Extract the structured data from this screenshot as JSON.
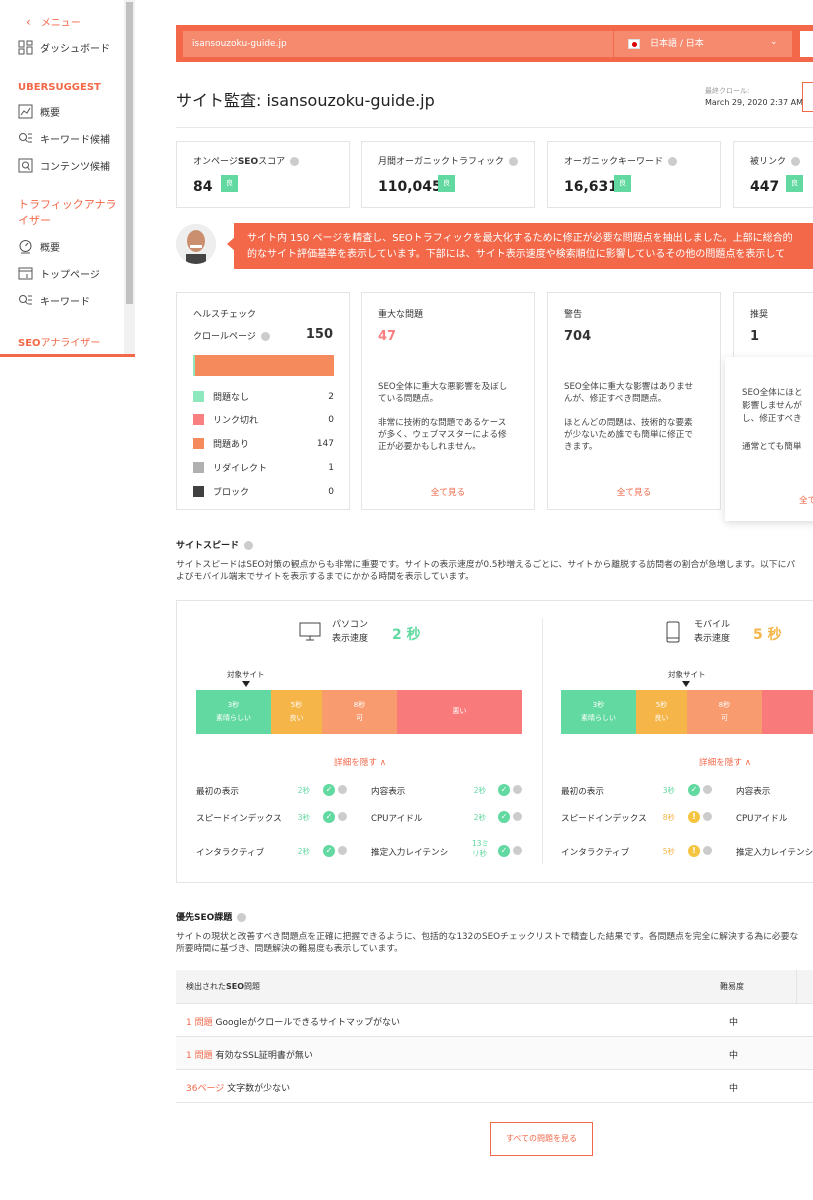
{
  "sidebar": {
    "menu_label": "メニュー",
    "dashboard": "ダッシュボード",
    "ubersuggest_heading": "UBERSUGGEST",
    "ub_items": [
      "概要",
      "キーワード候補",
      "コンテンツ候補"
    ],
    "traffic_heading": "トラフィックアナライザー",
    "traffic_items": [
      "概要",
      "トップページ",
      "キーワード"
    ],
    "seo_heading_prefix": "SEO",
    "seo_heading_suffix": "アナライザー"
  },
  "topbar": {
    "url_value": "isansouzoku-guide.jp",
    "language": "日本語 / 日本"
  },
  "header": {
    "title": "サイト監査: isansouzoku-guide.jp",
    "last_crawl_label": "最終クロール:",
    "last_crawl_value": "March 29, 2020 2:37 AM"
  },
  "metrics": [
    {
      "label_pre": "オンページ",
      "label_bold": "SEO",
      "label_post": "スコア",
      "value": "84",
      "badge": "良"
    },
    {
      "label_pre": "月間オーガニックトラフィック",
      "label_bold": "",
      "label_post": "",
      "value": "110,045",
      "badge": "良"
    },
    {
      "label_pre": "オーガニックキーワード",
      "label_bold": "",
      "label_post": "",
      "value": "16,631",
      "badge": "良"
    },
    {
      "label_pre": "被リンク",
      "label_bold": "",
      "label_post": "",
      "value": "447",
      "badge": "良"
    }
  ],
  "banner": {
    "line1": "サイト内 150 ページを精査し、SEOトラフィックを最大化するために修正が必要な問題点を抽出しました。上部に総合的",
    "line2": "的なサイト評価基準を表示しています。下部には、サイト表示速度や検索順位に影響しているその他の問題点を表示して"
  },
  "health": {
    "title": "ヘルスチェック",
    "crawl_label": "クロールページ",
    "crawl_value": "150",
    "legend": [
      {
        "label": "問題なし",
        "value": "2",
        "color": "#8de8bd"
      },
      {
        "label": "リンク切れ",
        "value": "0",
        "color": "#f98080"
      },
      {
        "label": "問題あり",
        "value": "147",
        "color": "#f58a5d"
      },
      {
        "label": "リダイレクト",
        "value": "1",
        "color": "#b0b0b0"
      },
      {
        "label": "ブロック",
        "value": "0",
        "color": "#404040"
      }
    ]
  },
  "issues": {
    "critical": {
      "title": "重大な問題",
      "value": "47",
      "desc1": "SEO全体に重大な悪影響を及ぼしている問題点。",
      "desc2": "非常に技術的な問題であるケースが多く、ウェブマスターによる修正が必要かもしれません。",
      "link": "全て見る"
    },
    "warning": {
      "title": "警告",
      "value": "704",
      "desc1": "SEO全体に重大な影響はありませんが、修正すべき問題点。",
      "desc2": "ほとんどの問題は、技術的な要素が少ないため誰でも簡単に修正できます。",
      "link": "全て見る"
    },
    "recommend": {
      "title": "推奨",
      "value": "1",
      "desc1": "SEO全体にほと",
      "desc1b": "影響しませんが",
      "desc1c": "し、修正すべき",
      "desc2": "通常とても簡単",
      "link": "全て"
    }
  },
  "speed": {
    "title": "サイトスピード",
    "desc1": "サイトスピードはSEO対策の観点からも非常に重要です。サイトの表示速度が0.5秒増えるごとに、サイトから離脱する訪問者の割合が急増します。以下にパ",
    "desc2": "よびモバイル端末でサイトを表示するまでにかかる時間を表示しています。",
    "desktop": {
      "name": "パソコン",
      "sub": "表示速度",
      "value": "2 秒"
    },
    "mobile": {
      "name": "モバイル",
      "sub": "表示速度",
      "value": "5 秒"
    },
    "target_label": "対象サイト",
    "segments": [
      {
        "t": "3秒",
        "l": "素晴らしい"
      },
      {
        "t": "5秒",
        "l": "良い"
      },
      {
        "t": "8秒",
        "l": "可"
      },
      {
        "t": "",
        "l": "悪い"
      }
    ],
    "toggle": "詳細を隠す ∧",
    "metrics_labels": [
      "最初の表示",
      "スピードインデックス",
      "インタラクティブ",
      "内容表示",
      "CPUアイドル",
      "推定入力レイテンシ"
    ],
    "desktop_values": [
      "2秒",
      "3秒",
      "2秒",
      "2秒",
      "2秒",
      "13ミリ秒"
    ],
    "mobile_values": [
      "3秒",
      "8秒",
      "5秒"
    ]
  },
  "priority": {
    "title": "優先SEO課題",
    "desc1": "サイトの現状と改善すべき問題点を正確に把握できるように、包括的な132のSEOチェックリストで精査した結果です。各問題点を完全に解決する為に必要な",
    "desc2": "所要時間に基づき、問題解決の難易度も表示しています。",
    "col1_pre": "検出された",
    "col1_bold": "SEO",
    "col1_post": "問題",
    "col2": "難易度",
    "rows": [
      {
        "count": "1 問題",
        "text": "Googleがクロールできるサイトマップがない",
        "level": "中"
      },
      {
        "count": "1 問題",
        "text": "有効なSSL証明書が無い",
        "level": "中"
      },
      {
        "count": "36ページ",
        "text": "文字数が少ない",
        "level": "中"
      }
    ],
    "see_all": "すべての問題を見る"
  }
}
